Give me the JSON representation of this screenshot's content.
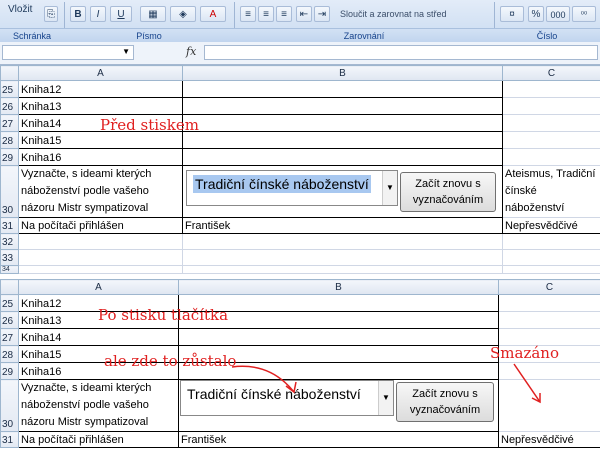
{
  "ribbon": {
    "groups": [
      "Schránka",
      "Písmo",
      "Zarovnání",
      "Číslo"
    ],
    "paste_label": "Vložit",
    "merge_label": "Sloučit a zarovnat na střed",
    "bold": "B",
    "italic": "I",
    "underline": "U",
    "percent": "%",
    "thousands": "000"
  },
  "formula_bar": {
    "name_box": "",
    "fx": "fx",
    "formula": ""
  },
  "columns": [
    "A",
    "B",
    "C"
  ],
  "top_sheet": {
    "rows": [
      {
        "num": "25",
        "a": "Kniha12"
      },
      {
        "num": "26",
        "a": "Kniha13"
      },
      {
        "num": "27",
        "a": "Kniha14"
      },
      {
        "num": "28",
        "a": "Kniha15"
      },
      {
        "num": "29",
        "a": "Kniha16"
      }
    ],
    "question_row": {
      "num": "30",
      "a": "Vyznačte, s ideami kterých náboženství podle vašeho názoru Mistr sympatizoval",
      "c": "Ateismus, Tradiční čínské náboženství"
    },
    "login_row": {
      "num": "31",
      "a": "Na počítači přihlášen",
      "b": "František",
      "c": "Nepřesvědčivé"
    },
    "empty_rows": [
      "32",
      "33",
      "34"
    ],
    "combo_value": "Tradiční čínské náboženství",
    "button_label": "Začít znovu s vyznačováním"
  },
  "bottom_sheet": {
    "rows": [
      {
        "num": "25",
        "a": "Kniha12"
      },
      {
        "num": "26",
        "a": "Kniha13"
      },
      {
        "num": "27",
        "a": "Kniha14"
      },
      {
        "num": "28",
        "a": "Kniha15"
      },
      {
        "num": "29",
        "a": "Kniha16"
      }
    ],
    "question_row": {
      "num": "30",
      "a": "Vyznačte, s ideami kterých náboženství podle vašeho názoru Mistr sympatizoval",
      "c": ""
    },
    "login_row": {
      "num": "31",
      "a": "Na počítači přihlášen",
      "b": "František",
      "c": "Nepřesvědčivé"
    },
    "combo_value": "Tradiční čínské náboženství",
    "button_label": "Začít znovu s vyznačováním"
  },
  "annotations": {
    "before": "Před stiskem",
    "after": "Po stisku tlačítka",
    "stayed": "ale zde to zůstalo",
    "deleted": "Smazáno"
  },
  "colors": {
    "annotation": "#e02020",
    "selection": "#a8c8f0"
  }
}
